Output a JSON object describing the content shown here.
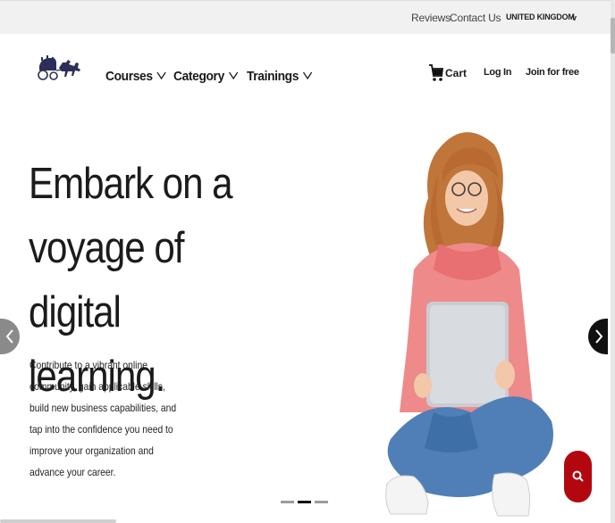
{
  "topbar": {
    "reviews": "Reviews",
    "contact": "Contact Us",
    "country": "UNITED KINGDOM",
    "country_chevron": "v"
  },
  "nav": {
    "logo_icon": "horse-carriage-logo",
    "items": [
      {
        "label": "Courses",
        "icon": "chevron-down-icon"
      },
      {
        "label": "Category",
        "icon": "chevron-down-icon"
      },
      {
        "label": "Trainings",
        "icon": "chevron-down-icon"
      }
    ],
    "cart_label": "Cart",
    "cart_icon": "cart-icon",
    "login": "Log In",
    "join": "Join for free"
  },
  "hero": {
    "title_line1": "Embark on a",
    "title_line2": "voyage of digital",
    "title_line3": "learning.",
    "subtitle": "Contribute to a vibrant online community, gain applicable skills, build new business capabilities, and tap into the confidence you need to improve your organization and advance your career.",
    "image": "woman-with-laptop"
  },
  "carousel": {
    "prev_icon": "chevron-left-icon",
    "next_icon": "chevron-right-icon",
    "slides": 3,
    "active_slide": 2
  },
  "colors": {
    "accent": "#b3070f",
    "text": "#1b1b1b",
    "topbar_bg": "#f1f1f1"
  },
  "search_fab_icon": "search-icon"
}
